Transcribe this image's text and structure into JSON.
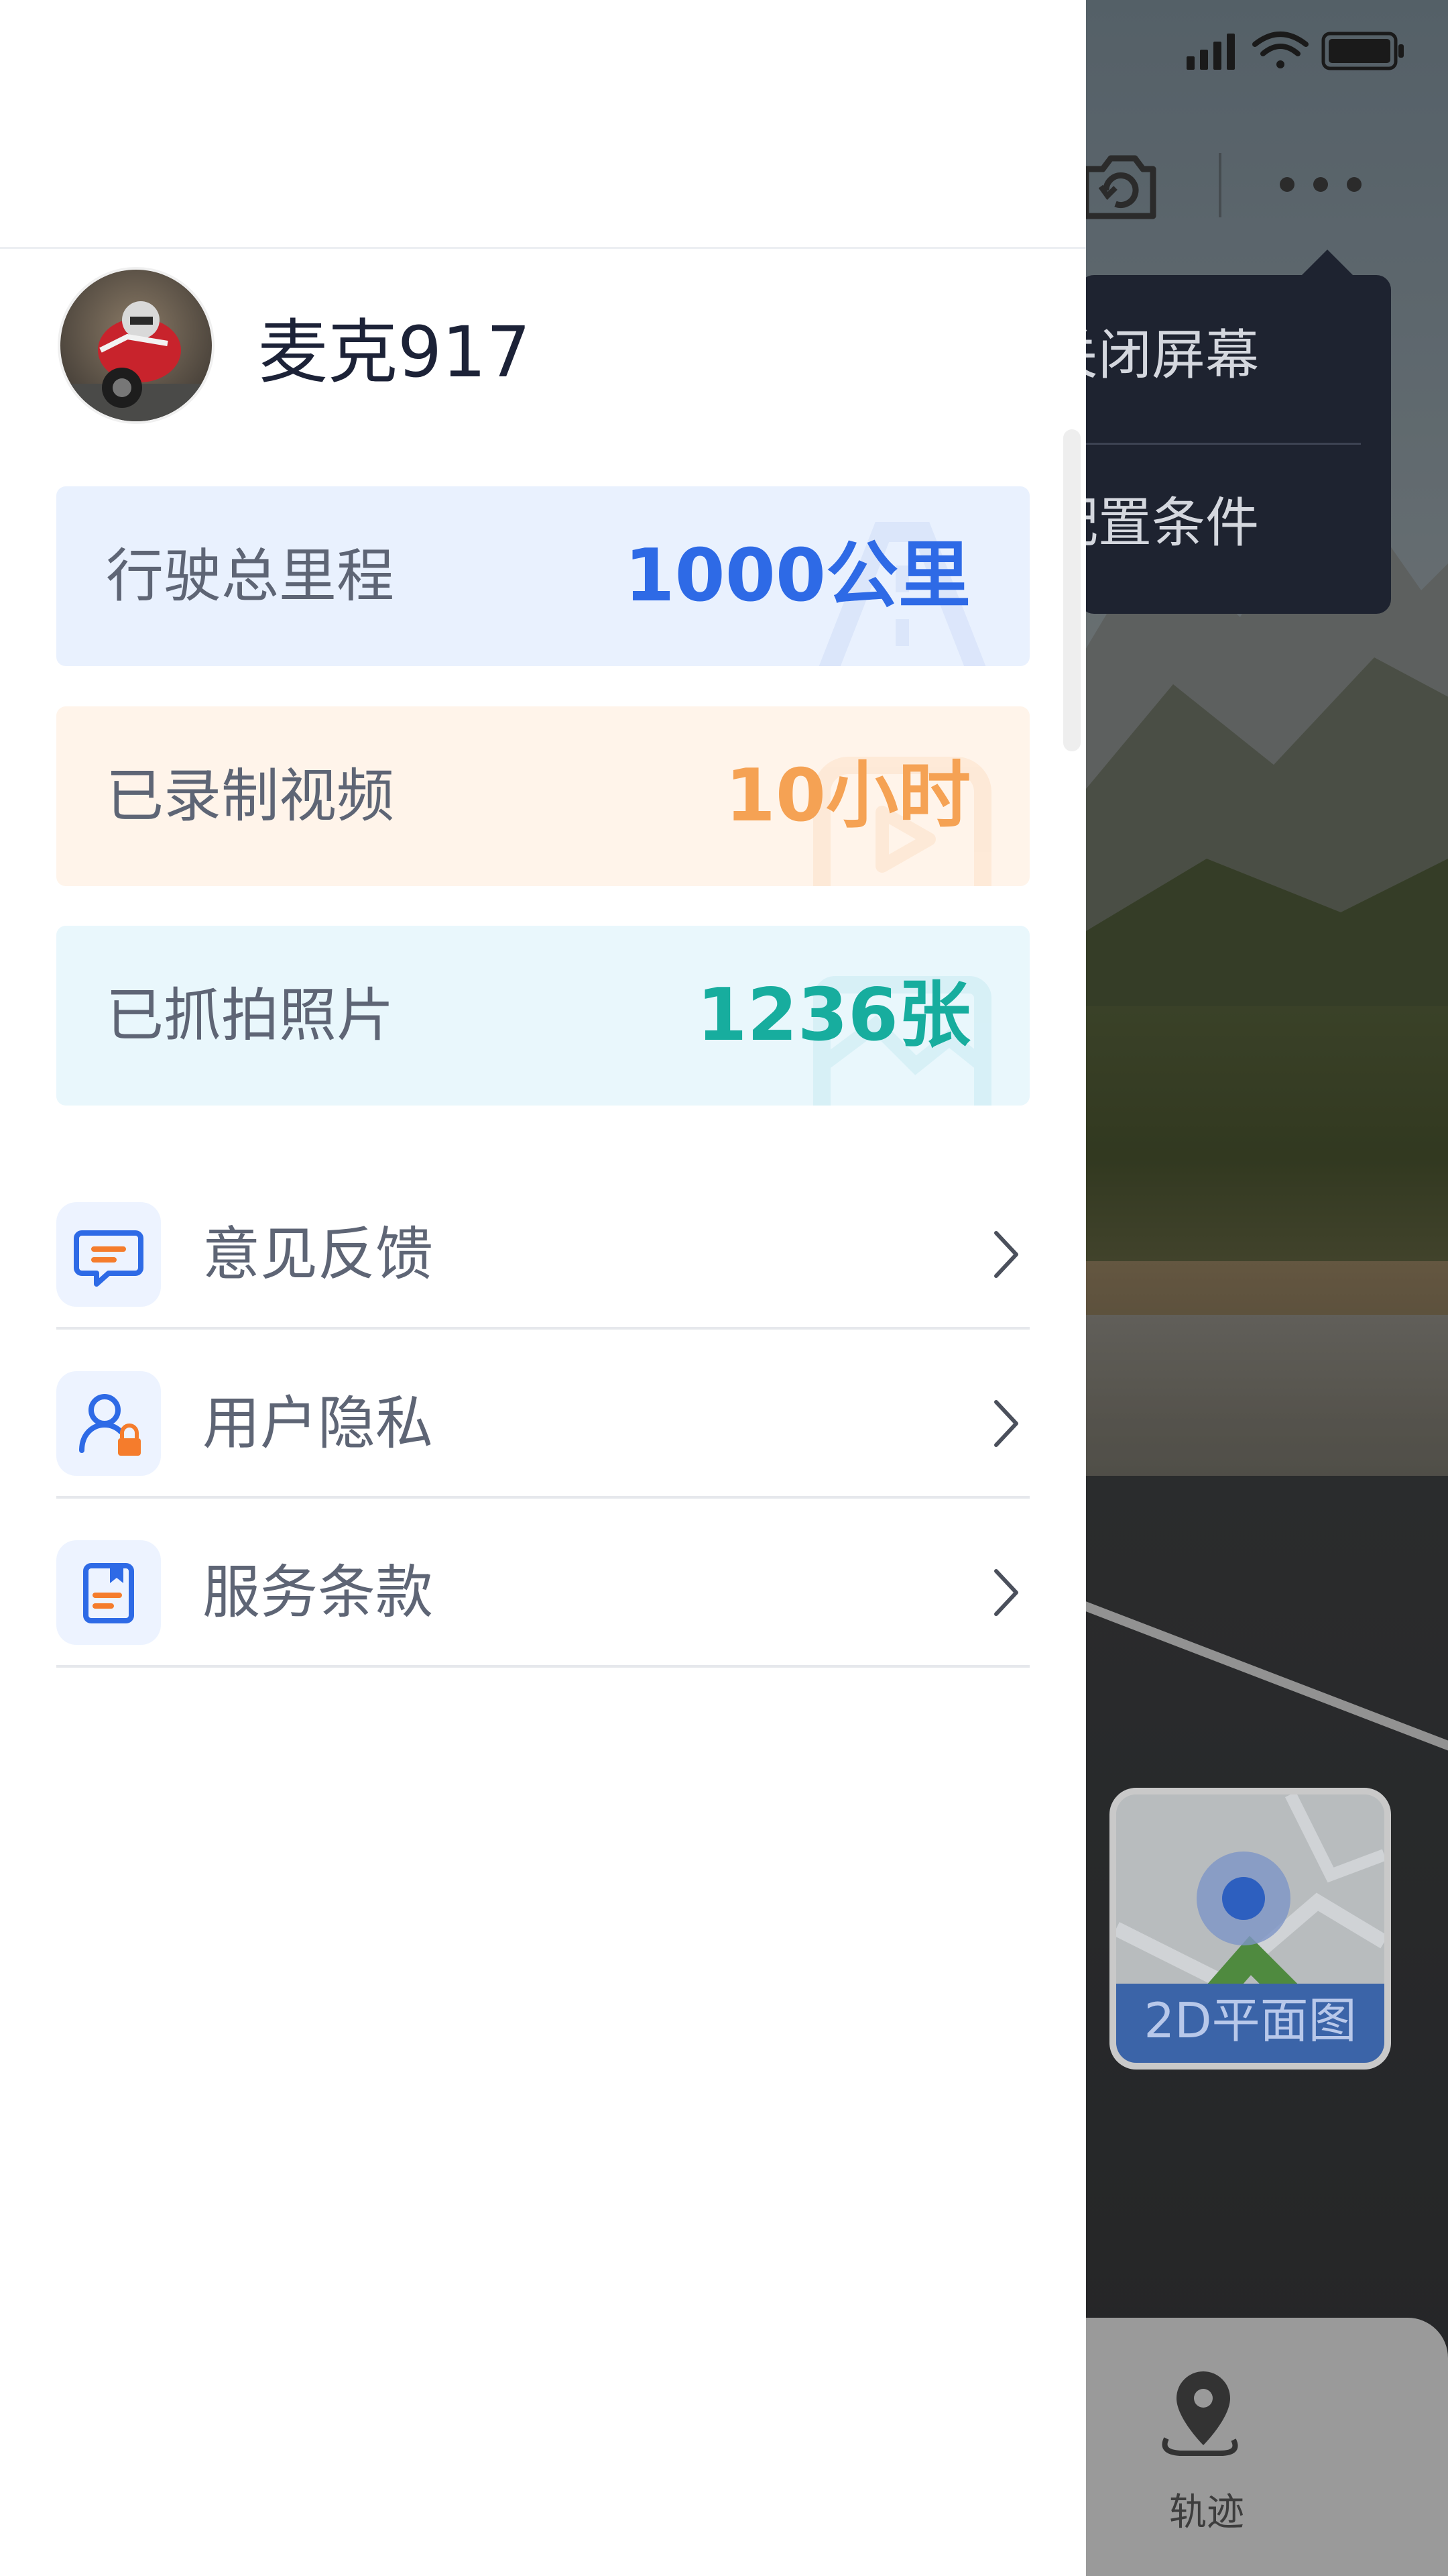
{
  "user": {
    "name": "麦克917"
  },
  "stats": {
    "mileage": {
      "label": "行驶总里程",
      "value": "1000公里"
    },
    "video": {
      "label": "已录制视频",
      "value": "10小时"
    },
    "photo": {
      "label": "已抓拍照片",
      "value": "1236张"
    }
  },
  "menu": {
    "feedback": {
      "label": "意见反馈",
      "icon": "chat-feedback-icon"
    },
    "privacy": {
      "label": "用户隐私",
      "icon": "user-lock-icon"
    },
    "terms": {
      "label": "服务条款",
      "icon": "document-icon"
    }
  },
  "background": {
    "popup": {
      "item1": "关闭屏幕",
      "item2": "配置条件"
    },
    "map_label": "2D平面图",
    "tab_label": "轨迹"
  },
  "colors": {
    "accent_blue": "#2e6ae6",
    "accent_orange": "#f5a254",
    "accent_teal": "#17ad9e",
    "popup_bg": "#1e2330"
  }
}
